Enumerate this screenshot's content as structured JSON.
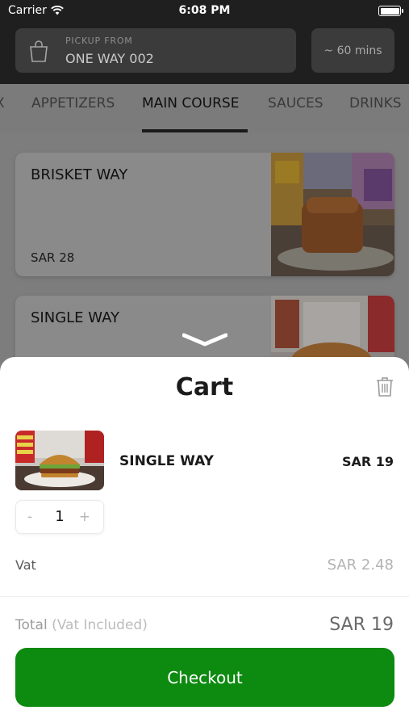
{
  "status_bar": {
    "carrier": "Carrier",
    "time": "6:08 PM"
  },
  "header": {
    "pickup_label": "PICKUP FROM",
    "pickup_value": "ONE WAY 002",
    "eta": "~ 60 mins"
  },
  "tabs": [
    {
      "label": "X"
    },
    {
      "label": "APPETIZERS"
    },
    {
      "label": "MAIN COURSE",
      "active": true
    },
    {
      "label": "SAUCES"
    },
    {
      "label": "DRINKS"
    }
  ],
  "menu": {
    "items": [
      {
        "name": "BRISKET WAY",
        "price": "SAR 28"
      },
      {
        "name": "SINGLE WAY"
      }
    ]
  },
  "cart": {
    "title": "Cart",
    "item": {
      "name": "SINGLE WAY",
      "price": "SAR 19",
      "quantity": "1"
    },
    "stepper": {
      "minus": "-",
      "plus": "+"
    },
    "vat_label": "Vat",
    "vat_value": "SAR 2.48",
    "total_label": "Total",
    "total_sub": "(Vat Included)",
    "total_value": "SAR 19",
    "checkout_label": "Checkout"
  },
  "colors": {
    "accent": "#0d8a10",
    "header_bg": "#1f1f1f"
  },
  "icons": [
    "wifi-icon",
    "battery-icon",
    "shopping-bag-icon",
    "chevron-down-icon",
    "trash-icon"
  ]
}
